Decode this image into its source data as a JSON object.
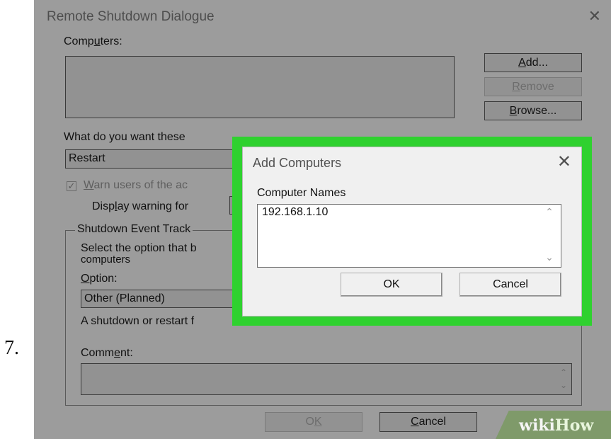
{
  "step_number": "7.",
  "background_dialog": {
    "title": "Remote Shutdown Dialogue",
    "close_glyph": "✕",
    "computers_label_pre": "Comp",
    "computers_label_u": "u",
    "computers_label_post": "ters:",
    "add_button_u": "A",
    "add_button_rest": "dd...",
    "remove_button_u": "R",
    "remove_button_rest": "emove",
    "browse_button_u": "B",
    "browse_button_rest": "rowse...",
    "what_do_label": "What do you want these",
    "action_select_value": "Restart",
    "warn_check_glyph": "✓",
    "warn_label_u": "W",
    "warn_label_rest": "arn users of the ac",
    "display_warning_pre": "Disp",
    "display_warning_u": "l",
    "display_warning_post": "ay warning for",
    "tracker_group_title": "Shutdown Event Track",
    "select_option_line1": "Select the option that b",
    "select_option_line2": "computers",
    "option_label_u": "O",
    "option_label_rest": "ption:",
    "option_select_value": "Other (Planned)",
    "shutdown_desc": "A shutdown or restart f",
    "comment_label_pre": "Comm",
    "comment_label_u": "e",
    "comment_label_post": "nt:",
    "ok_button_pre": "O",
    "ok_button_u": "K",
    "cancel_button_u": "C",
    "cancel_button_rest": "ancel"
  },
  "watermark": {
    "part1": "wiki",
    "part2": "How"
  },
  "add_computers_dialog": {
    "title": "Add Computers",
    "close_glyph": "✕",
    "computer_names_label": "Computer Names",
    "computer_names_value": "192.168.1.10",
    "ok_label": "OK",
    "cancel_label": "Cancel"
  },
  "colors": {
    "highlight": "#2fd12f",
    "dim_overlay": "#9c9c9c",
    "watermark_bg": "#7f9a6a"
  },
  "icons": {
    "close": "close-icon",
    "checkbox": "checkmark-icon",
    "scroll_up": "chevron-up-icon",
    "scroll_down": "chevron-down-icon"
  }
}
